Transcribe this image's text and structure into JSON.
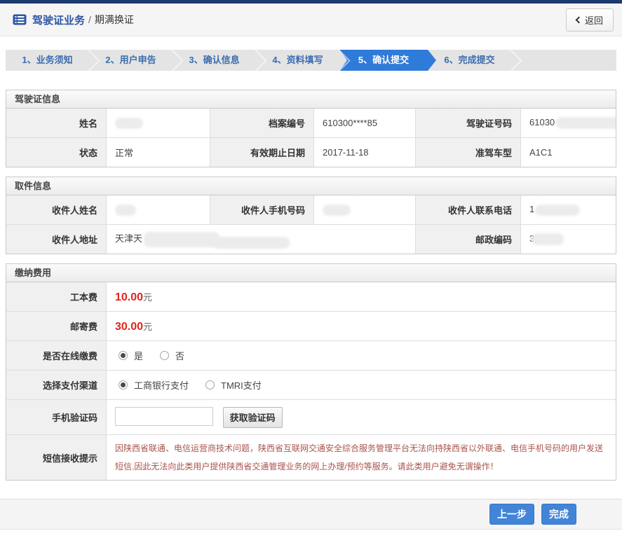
{
  "titlebar": {
    "title": "驾驶证业务",
    "divider": "/",
    "subtitle": "期满换证",
    "back_button": "返回"
  },
  "steps": {
    "items": [
      {
        "label": "1、业务须知",
        "active": false
      },
      {
        "label": "2、用户申告",
        "active": false
      },
      {
        "label": "3、确认信息",
        "active": false
      },
      {
        "label": "4、资料填写",
        "active": false
      },
      {
        "label": "5、确认提交",
        "active": true
      },
      {
        "label": "6、完成提交",
        "active": false
      }
    ]
  },
  "license_info": {
    "title": "驾驶证信息",
    "name": {
      "label": "姓名",
      "value": "",
      "redacted": true
    },
    "file_no": {
      "label": "档案编号",
      "value": "610300****85"
    },
    "license_no": {
      "label": "驾驶证号码",
      "value": "61030",
      "redacted": true
    },
    "status": {
      "label": "状态",
      "value": "正常"
    },
    "valid_until": {
      "label": "有效期止日期",
      "value": "2017-11-18"
    },
    "vehicle_class": {
      "label": "准驾车型",
      "value": "A1C1"
    }
  },
  "pickup_info": {
    "title": "取件信息",
    "recipient_name": {
      "label": "收件人姓名",
      "value": "",
      "redacted": true
    },
    "recipient_mobile": {
      "label": "收件人手机号码",
      "value": "",
      "redacted": true
    },
    "recipient_phone": {
      "label": "收件人联系电话",
      "value": "1",
      "redacted": true
    },
    "recipient_address": {
      "label": "收件人地址",
      "value": "天津天",
      "redacted": true
    },
    "postal_code": {
      "label": "邮政编码",
      "value": "3",
      "redacted": true
    }
  },
  "payment": {
    "title": "缴纳费用",
    "production_fee": {
      "label": "工本费",
      "amount": "10.00",
      "unit": "元"
    },
    "mailing_fee": {
      "label": "邮寄费",
      "amount": "30.00",
      "unit": "元"
    },
    "online_payment": {
      "label": "是否在线缴费",
      "options": [
        {
          "label": "是",
          "selected": true
        },
        {
          "label": "否",
          "selected": false
        }
      ]
    },
    "channel": {
      "label": "选择支付渠道",
      "options": [
        {
          "label": "工商银行支付",
          "selected": true
        },
        {
          "label": "TMRI支付",
          "selected": false
        }
      ]
    },
    "sms_code": {
      "label": "手机验证码",
      "input_value": "",
      "button": "获取验证码"
    },
    "sms_notice": {
      "label": "短信接收提示",
      "text": "因陕西省联通、电信运营商技术问题，陕西省互联网交通安全综合服务管理平台无法向持陕西省以外联通、电信手机号码的用户发送短信,因此无法向此类用户提供陕西省交通管理业务的网上办理/预约等服务。请此类用户避免无谓操作！"
    }
  },
  "actions": {
    "prev": "上一步",
    "finish": "完成"
  }
}
